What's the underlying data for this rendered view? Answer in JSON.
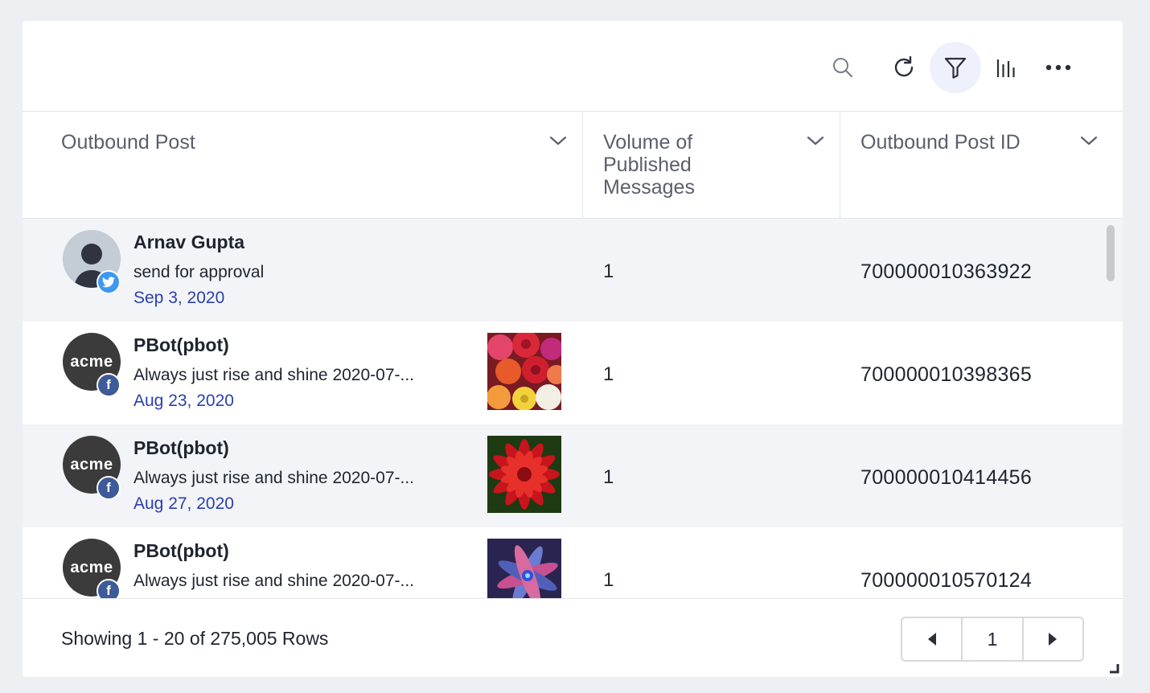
{
  "toolbar": {
    "icons": [
      "search-icon",
      "refresh-icon",
      "filter-icon",
      "columns-chart-icon",
      "more-icon"
    ],
    "active": "filter-icon",
    "active_bg": "#eef0fb"
  },
  "columns": [
    {
      "label": "Outbound Post"
    },
    {
      "label": "Volume of Published Messages"
    },
    {
      "label": "Outbound Post ID"
    }
  ],
  "rows": [
    {
      "author": "Arnav Gupta",
      "message": "send for approval",
      "date": "Sep 3, 2020",
      "channel": "twitter",
      "avatar": "default-avatar",
      "volume": "1",
      "post_id": "700000010363922"
    },
    {
      "author": "PBot(pbot)",
      "message": "Always just rise and shine 2020-07-...",
      "date": "Aug 23, 2020",
      "channel": "facebook",
      "avatar": "acme",
      "thumbnail": "roses-image",
      "volume": "1",
      "post_id": "700000010398365"
    },
    {
      "author": "PBot(pbot)",
      "message": "Always just rise and shine 2020-07-...",
      "date": "Aug 27, 2020",
      "channel": "facebook",
      "avatar": "acme",
      "thumbnail": "red-dahlia-image",
      "volume": "1",
      "post_id": "700000010414456"
    },
    {
      "author": "PBot(pbot)",
      "message": "Always just rise and shine 2020-07-...",
      "date": "",
      "channel": "facebook",
      "avatar": "acme",
      "thumbnail": "abstract-flower-image",
      "volume": "1",
      "post_id": "700000010570124"
    }
  ],
  "avatar_text": "acme",
  "facebook_glyph": "f",
  "footer": {
    "showing": "Showing 1 - 20 of 275,005 Rows",
    "page": "1"
  },
  "colors": {
    "link_date": "#2a3fb0",
    "twitter": "#3b99f0",
    "facebook": "#3d5a99",
    "row_alt": "#f3f4f7",
    "page_bg": "#eeeff3"
  }
}
